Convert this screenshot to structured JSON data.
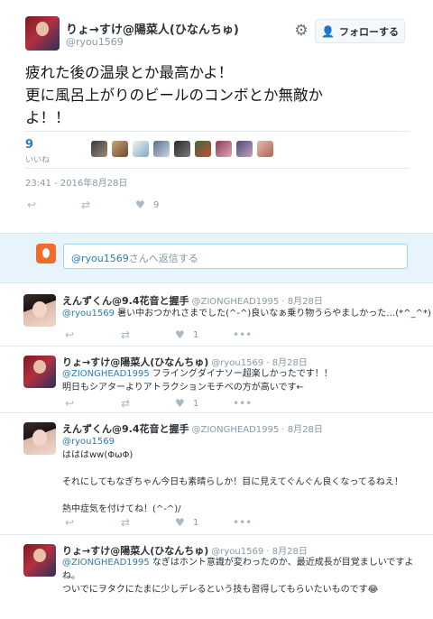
{
  "tweet": {
    "author_name": "りょ→すけ@陽菜人(ひなんちゅ)",
    "author_handle": "@ryou1569",
    "follow_label": "フォローする",
    "text_lines": [
      "疲れた後の温泉とか最高かよ！",
      "更に風呂上がりのビールのコンボとか無敵か",
      "よ！！"
    ],
    "likes_count": "9",
    "likes_label": "いいね",
    "timestamp": "23:41 - 2016年8月28日",
    "action_like_count": "9"
  },
  "reply_box": {
    "mention": "@ryou1569",
    "placeholder_suffix": "さんへ返信する"
  },
  "replies": [
    {
      "name": "えんずくん@9.4花音と握手",
      "meta": "@ZIONGHEAD1995 · 8月28日",
      "mention": "@ryou1569",
      "lines": [
        " 暑い中おつかれさまでした(^-^)良いなぁ乗り物うらやましかった…(*^_^*)"
      ],
      "like_count": "1"
    },
    {
      "name": "りょ→すけ@陽菜人(ひなんちゅ)",
      "meta": "@ryou1569 · 8月28日",
      "mention": "@ZIONGHEAD1995",
      "lines": [
        " フライングダイナソー超楽しかったです！！",
        "明日もシアターよりアトラクションモチベの方が高いです←"
      ],
      "like_count": "1"
    },
    {
      "name": "えんずくん@9.4花音と握手",
      "meta": "@ZIONGHEAD1995 · 8月28日",
      "mention": "@ryou1569",
      "lines": [
        "はははww(ΦωΦ)",
        "",
        "それにしてもなぎちゃん今日も素晴らしか！目に見えてぐんぐん良くなってるねえ！",
        "",
        "熱中症気を付けてね！(^-^)/"
      ],
      "like_count": "1"
    },
    {
      "name": "りょ→すけ@陽菜人(ひなんちゅ)",
      "meta": "@ryou1569 · 8月28日",
      "mention": "@ZIONGHEAD1995",
      "lines": [
        " なぎはホント意識が変わったのか、最近成長が目覚ましいですよ",
        "ね。",
        "ついでにヲタクにたまに少しデレるという技も習得してもらいたいものです😂"
      ],
      "like_count": "1"
    }
  ],
  "icons": {
    "gear": "gear-icon",
    "follow": "person-plus-icon",
    "reply": "reply-icon",
    "retweet": "retweet-icon",
    "like": "heart-icon",
    "more": "more-icon"
  },
  "colors": {
    "accent": "#2b7bb9",
    "muted": "#8899a6",
    "reply_bg": "#e8f4fb"
  }
}
